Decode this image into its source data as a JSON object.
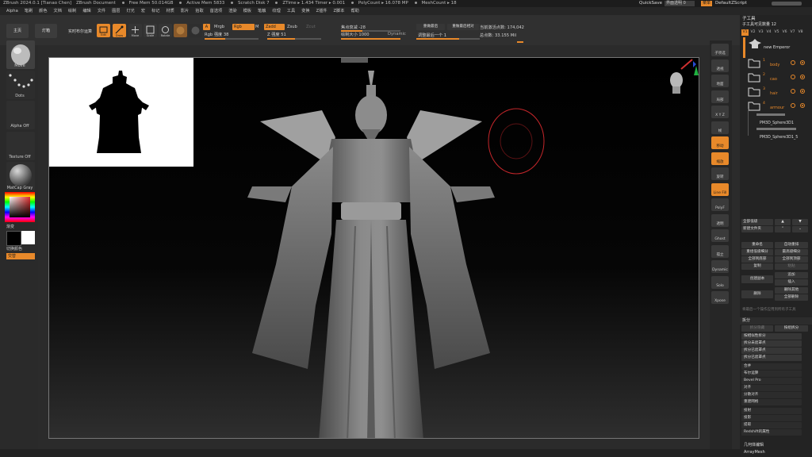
{
  "title_bar": {
    "app": "ZBrush 2024.0.1 [Tianao Chen]",
    "document": "ZBrush Document",
    "free_mem": "Free Mem 50.014GB",
    "active_mem": "Active Mem 5833",
    "scratch_disk": "Scratch Disk 7",
    "ztime": "ZTime ▸ 1.434 Timer ▸ 0.001",
    "poly_count": "PolyCount ▸ 16.078 MP",
    "mesh_count": "MeshCount ▸ 18",
    "quicksave": "QuickSave",
    "transparency": "界面透明 0",
    "menu_btn": "菜单",
    "default_script": "DefaultZScript"
  },
  "menu_bar": [
    "Alpha",
    "笔刷",
    "颜色",
    "文档",
    "绘制",
    "编辑",
    "文件",
    "图层",
    "灯光",
    "宏",
    "标记",
    "材质",
    "影片",
    "拾取",
    "首选项",
    "渲染",
    "模板",
    "笔触",
    "纹理",
    "工具",
    "变换",
    "Z插件",
    "Z脚本",
    "帮助"
  ],
  "toolbar": {
    "home_btn": "主页",
    "lightbox_btn": "灯箱",
    "live_boolean": "实时布尔运算",
    "edit_label": "Edit",
    "draw_label": "Draw",
    "move_label": "Move",
    "scale_label": "Scale",
    "rotate_label": "Rotate",
    "a_label": "A",
    "mrgb_label": "Mrgb",
    "rgb_label": "Rgb",
    "m_label": "M",
    "zadd_label": "Zadd",
    "zsub_label": "Zsub",
    "zcut_label": "Zcut",
    "rgb_intensity": "Rgb 强度 38",
    "z_intensity": "Z 强度 51",
    "focal_shift": "焦点衰减 -28",
    "draw_size": "绘制大小 1000",
    "dynamic": "Dynamic",
    "restore_last": "重做最后",
    "restore_last_rel": "重做最后相对",
    "adjust_last": "调整最后一个 1",
    "active_points": "当前激活点数: 174,042",
    "total_points": "总点数: 33.155 Mil"
  },
  "left_shelf": {
    "brush_label": "Move",
    "stroke_label": "Dots",
    "alpha_label": "Alpha Off",
    "texture_label": "Texture Off",
    "material_label": "MatCap Gray",
    "gradient_label": "渐变",
    "switch_color_label": "切换颜色",
    "alternate_label": "交替"
  },
  "right_shelf": [
    "子项选",
    "透视",
    "地面",
    "局部",
    "X Y Z",
    "帧",
    "移动",
    "缩放",
    "旋转",
    "Line Fill",
    "PolyF",
    "透明",
    "Ghost",
    "孤立",
    "Dynamic",
    "Solo",
    "Xpose"
  ],
  "right_panel": {
    "header": "子工具",
    "count_label": "子工具可见数量 12",
    "version_tabs": [
      "V1",
      "V2",
      "V3",
      "V4",
      "V5",
      "V6",
      "V7",
      "V8"
    ],
    "subtools": [
      {
        "name": "new Emperor",
        "index": ""
      },
      {
        "name": "body",
        "index": "1"
      },
      {
        "name": "cao",
        "index": "2"
      },
      {
        "name": "hair",
        "index": "3"
      },
      {
        "name": "armour",
        "index": "4"
      },
      {
        "name": "PM3D_Sphere3D1",
        "index": ""
      },
      {
        "name": "PM3D_Sphere3D1_5",
        "index": ""
      }
    ],
    "all_low": "全部低级",
    "new_folder": "新建文件夹",
    "rename": "重命名",
    "auto_reorder": "自动重排",
    "all_low2": "重组低级细分",
    "all_high": "最高级细分",
    "all_to_low": "全部到底部",
    "all_to_high": "全部到顶部",
    "copy": "复制",
    "paste": "粘贴",
    "append": "追加",
    "insert": "插入",
    "duplicate": "创建副本",
    "delete": "删除",
    "del_other": "删除其他",
    "del_all": "全部删除",
    "hint": "将最后一个操作应用到所有子工具",
    "split_section": "拆分",
    "split_hidden": "拆分隐藏",
    "split_polygroups": "按组拆分",
    "groups_split": "按相似性拆分",
    "split_unmasked": "拆分未遮罩点",
    "split_masked": "拆分已遮罩点",
    "merge": "合并",
    "boolean": "布尔运算",
    "bevel_pro": "Bevel Pro",
    "align": "对齐",
    "distribute": "分散对齐",
    "remesh": "重建网格",
    "project": "投射",
    "extract": "投影",
    "extract2": "提取",
    "redshift": "Redshift的属性",
    "geom_edit": "几何体编辑",
    "arraymesh": "ArrayMesh"
  },
  "colors": {
    "accent": "#e8892a",
    "bg": "#2b2b2b",
    "panel": "#232323"
  }
}
